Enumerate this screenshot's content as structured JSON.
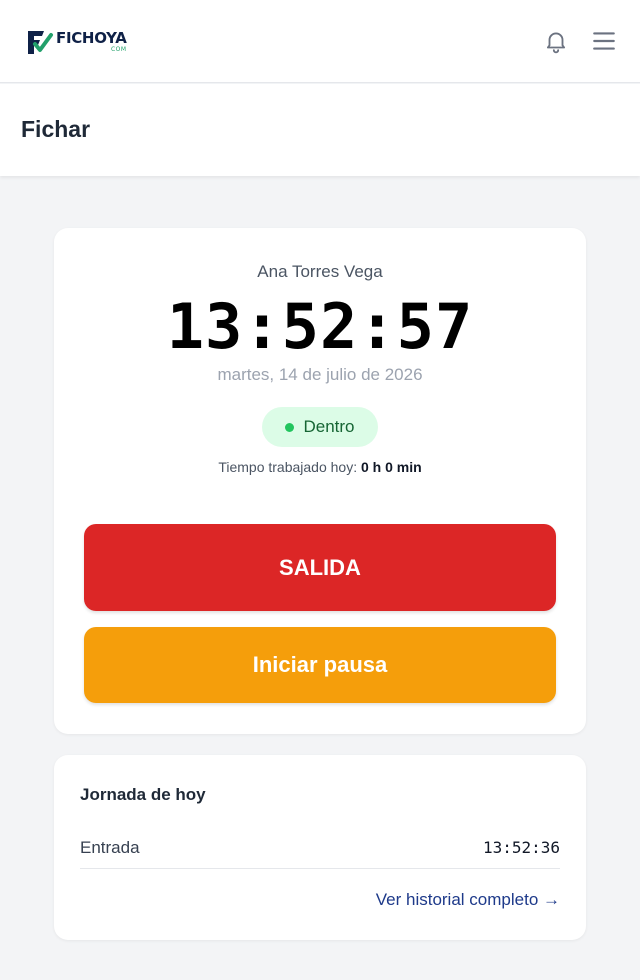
{
  "header": {
    "logo_text": "FICHOYA",
    "logo_sub": "COM",
    "icons": [
      "bell-icon",
      "hamburger-menu-icon"
    ]
  },
  "page": {
    "title": "Fichar"
  },
  "clock_card": {
    "employee_name": "Ana Torres Vega",
    "time": "13:52:57",
    "date": "martes, 14 de julio de 2026",
    "status": {
      "label": "Dentro",
      "color": "#22c55e"
    },
    "worked_label": "Tiempo trabajado hoy:",
    "worked_value": "0 h 0 min",
    "exit_button": {
      "label": "SALIDA",
      "color": "#dc2626"
    },
    "pause_button": {
      "label": "Iniciar pausa",
      "color": "#f59e0b"
    }
  },
  "today_card": {
    "title": "Jornada de hoy",
    "entries": [
      {
        "label": "Entrada",
        "value": "13:52:36"
      }
    ],
    "history_link": "Ver historial completo →"
  },
  "colors": {
    "brand_navy": "#0f2147",
    "brand_green": "#22a06b",
    "link": "#1e3a8a"
  }
}
